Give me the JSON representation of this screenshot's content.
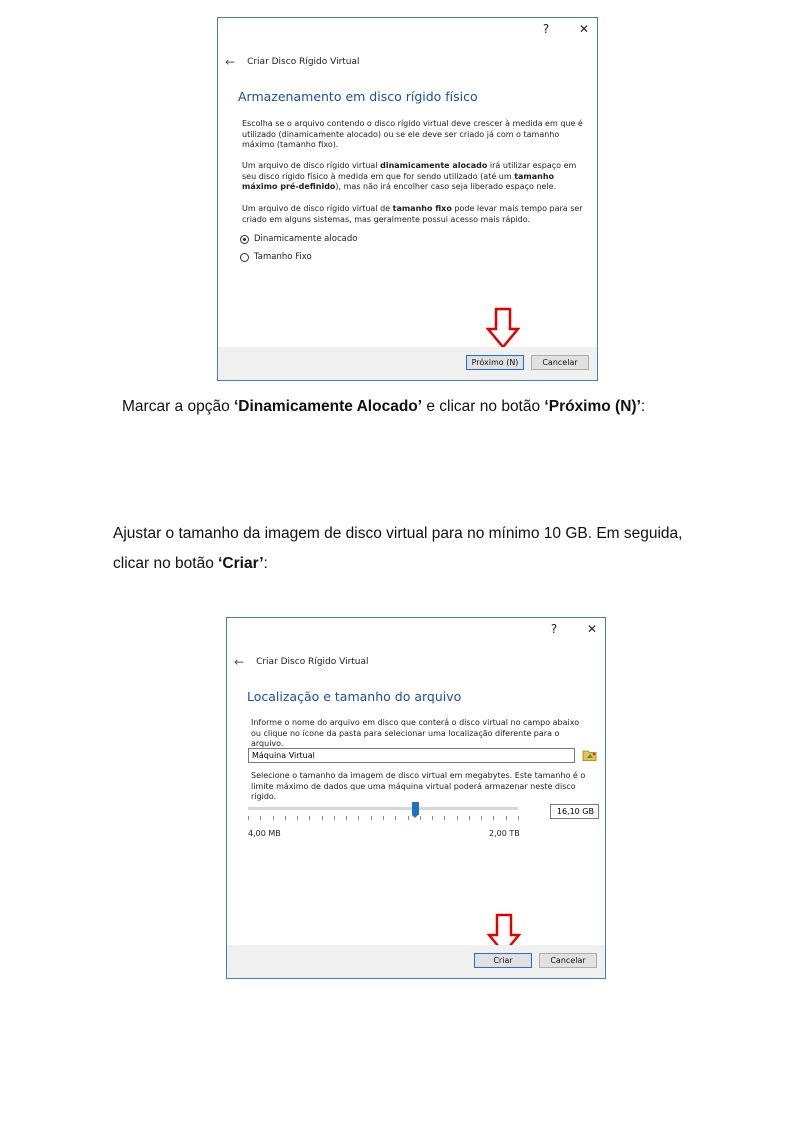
{
  "dialog1": {
    "help_glyph": "?",
    "close_glyph": "✕",
    "back_glyph": "←",
    "title": "Criar Disco Rígido Virtual",
    "section_title": "Armazenamento em disco rígido físico",
    "para1": "Escolha se o arquivo contendo o disco rígido virtual deve crescer à medida em que é utilizado (dinamicamente alocado) ou se ele deve ser criado já com o tamanho máximo (tamanho fixo).",
    "para2_pre": "Um arquivo de disco rígido virtual ",
    "para2_bold1": "dinamicamente alocado",
    "para2_mid": " irá utilizar espaço em seu disco rígido físico à medida em que for sendo utilizado (até um ",
    "para2_bold2": "tamanho máximo pré-definido",
    "para2_post": "), mas não irá encolher caso seja liberado espaço nele.",
    "para3_pre": "Um arquivo de disco rígido virtual de ",
    "para3_bold": "tamanho fixo",
    "para3_post": " pode levar mais tempo para ser criado em alguns sistemas, mas geralmente possui acesso mais rápido.",
    "radio_dynamic_label": "Dinamicamente alocado",
    "radio_fixed_label": "Tamanho Fixo",
    "next_button": "Próximo (N)",
    "cancel_button": "Cancelar"
  },
  "caption1": {
    "pre": "Marcar a opção ",
    "bold1": "‘Dinamicamente Alocado’",
    "mid": " e clicar no botão ",
    "bold2": "‘Próximo (N)’",
    "post": ":"
  },
  "caption2": {
    "line1": "Ajustar o tamanho da imagem de disco virtual para no mínimo 10 GB. Em seguida,",
    "line2_pre": "clicar no botão ",
    "line2_bold": "‘Criar’",
    "line2_post": ":"
  },
  "dialog2": {
    "help_glyph": "?",
    "close_glyph": "✕",
    "back_glyph": "←",
    "title": "Criar Disco Rígido Virtual",
    "section_title": "Localização e tamanho do arquivo",
    "para1": "Informe o nome do arquivo em disco que conterá o disco virtual no campo abaixo ou clique no ícone da pasta para selecionar uma localização diferente para o arquivo.",
    "file_name_value": "Máquina Virtual",
    "para2": "Selecione o tamanho da imagem de disco virtual em megabytes. Este tamanho é o limite máximo de dados que uma máquina virtual poderá armazenar neste disco rígido.",
    "size_value": "16,10 GB",
    "slider_fraction": 0.62,
    "min_label": "4,00 MB",
    "max_label": "2,00 TB",
    "create_button": "Criar",
    "cancel_button": "Cancelar"
  },
  "colors": {
    "accent_blue": "#1a4f9c",
    "arrow_red": "#e00000",
    "dialog_border": "#4a7fb5"
  }
}
